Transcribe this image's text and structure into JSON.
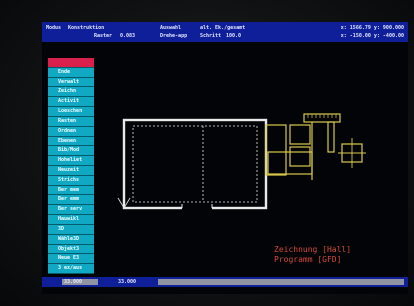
{
  "status": {
    "modus_label": "Modus",
    "modus_value": "Konstruktion",
    "auswahl_label": "Auswahl",
    "auswahl_value": "alt. Ek./gesamt",
    "raster_label": "Raster",
    "raster_value": "0.083",
    "drehe_label": "Drehe-app",
    "schritt_label": "Schritt",
    "schritt_value": "100.0",
    "coord_x1": "x: 1566.79",
    "coord_y1": "y: 900.000",
    "coord_x2": "x: -150.00",
    "coord_y2": "y: -400.00"
  },
  "menu": {
    "items": [
      {
        "label": "",
        "active": true
      },
      {
        "label": "Ende",
        "active": false
      },
      {
        "label": "Verwalt",
        "active": false
      },
      {
        "label": "Zeichn",
        "active": false
      },
      {
        "label": "Activit",
        "active": false
      },
      {
        "label": "Loeschen",
        "active": false
      },
      {
        "label": "Rasten",
        "active": false
      },
      {
        "label": "Ordnen",
        "active": false
      },
      {
        "label": "Ebenen",
        "active": false
      },
      {
        "label": "Bib/Mod",
        "active": false
      },
      {
        "label": "Hoheliet",
        "active": false
      },
      {
        "label": "Neuzeit",
        "active": false
      },
      {
        "label": "Strichs",
        "active": false
      },
      {
        "label": "Ber mem",
        "active": false
      },
      {
        "label": "Ber emm",
        "active": false
      },
      {
        "label": "Ber serv",
        "active": false
      },
      {
        "label": "Hauwikl",
        "active": false
      },
      {
        "label": "3D",
        "active": false
      },
      {
        "label": "Wähle3D",
        "active": false
      },
      {
        "label": "Objekt3",
        "active": false
      },
      {
        "label": "Neue E3",
        "active": false
      },
      {
        "label": "3 ex/aus",
        "active": false
      }
    ]
  },
  "bottom": {
    "value_left": "33.000",
    "value_right": "33.000"
  },
  "caption": {
    "line1": "Zeichnung [Hall]",
    "line2": "Programm [GFD]"
  },
  "colors": {
    "statusbar": "#0f1f9a",
    "menu": "#11a8c4",
    "menu_active": "#d7204b",
    "wall": "#e9e9e9",
    "furniture": "#d8c94a",
    "caption": "#d44a38"
  }
}
